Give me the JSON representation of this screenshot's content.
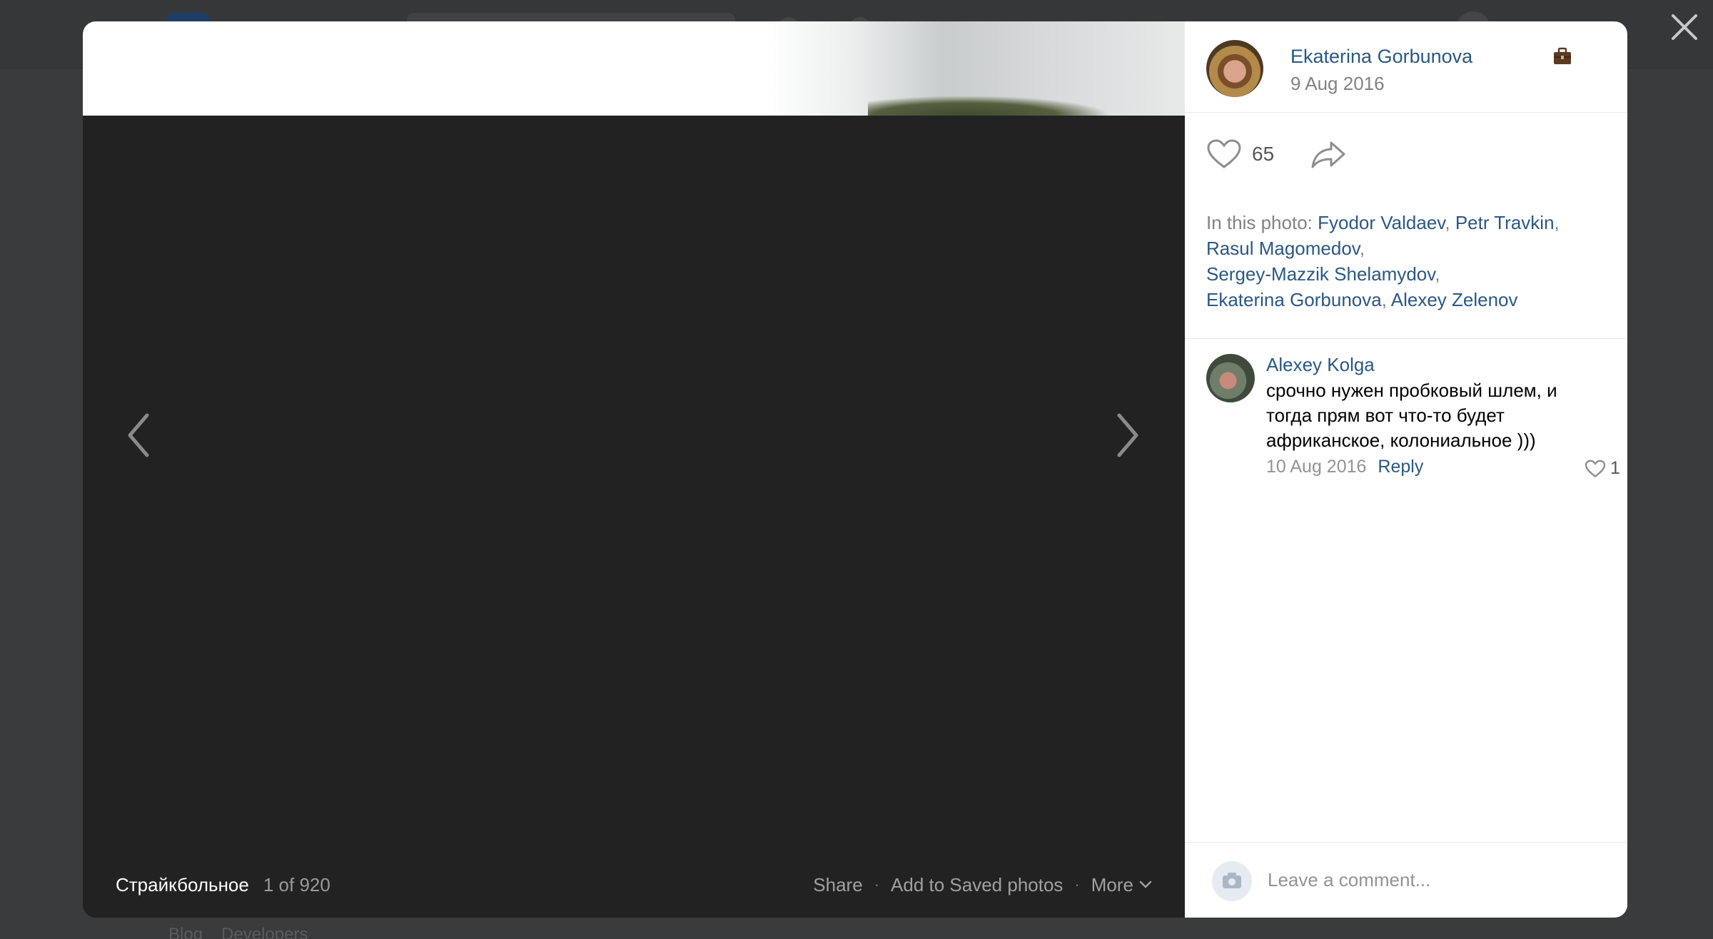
{
  "background": {
    "footer_links": [
      "Blog",
      "Developers"
    ]
  },
  "viewer": {
    "album_title": "Страйкбольное",
    "counter": "1 of 920",
    "actions": {
      "share": "Share",
      "save": "Add to Saved photos",
      "more": "More"
    }
  },
  "post": {
    "author_name": "Ekaterina Gorbunova",
    "date": "9 Aug 2016",
    "likes": "65",
    "tags_label": "In this photo:",
    "tagged": [
      "Fyodor Valdaev",
      "Petr Travkin",
      "Rasul Magomedov",
      "Sergey-Mazzik Shelamydov",
      "Ekaterina Gorbunova",
      "Alexey Zelenov"
    ]
  },
  "comments": [
    {
      "author": "Alexey Kolga",
      "text": "срочно нужен пробковый шлем, и тогда прям вот что-то будет африканское, колониальное )))",
      "date": "10 Aug 2016",
      "reply_label": "Reply",
      "likes": "1"
    }
  ],
  "comment_box": {
    "placeholder": "Leave a comment..."
  },
  "icons": {
    "close": "close-icon",
    "prev": "chevron-left-icon",
    "next": "chevron-right-icon",
    "like": "heart-icon",
    "share": "share-arrow-icon",
    "briefcase": "briefcase-icon",
    "camera": "camera-icon",
    "more": "chevron-down-icon"
  },
  "colors": {
    "link": "#2a5885",
    "photo_bg": "#222222",
    "overlay": "#3a3b3c"
  }
}
